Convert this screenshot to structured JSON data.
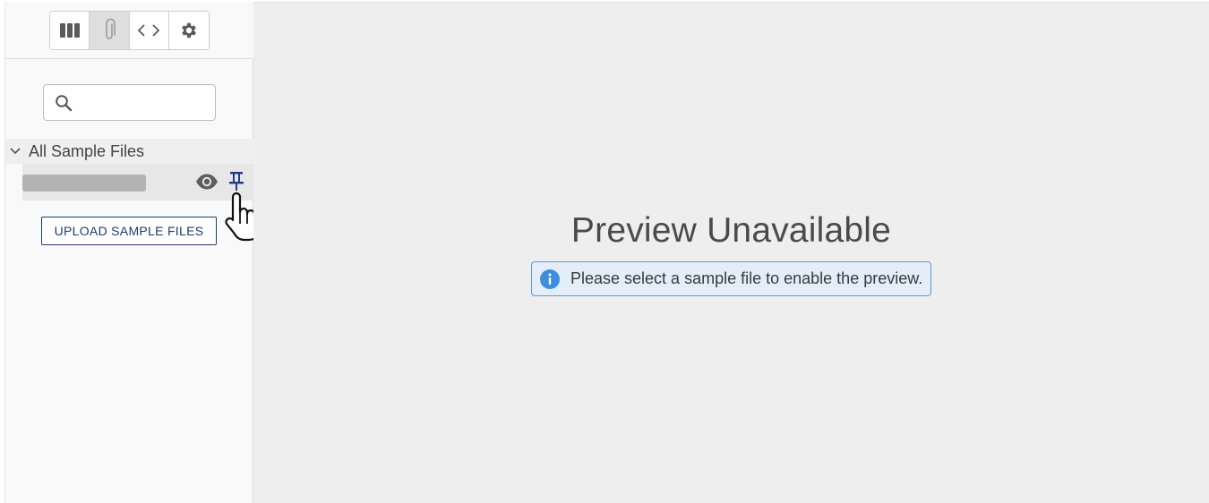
{
  "toolbar": {
    "buttons": [
      {
        "name": "columns-icon",
        "active": false
      },
      {
        "name": "paperclip-icon",
        "active": true
      },
      {
        "name": "code-icon",
        "active": false
      },
      {
        "name": "gear-icon",
        "active": false
      }
    ]
  },
  "search": {
    "placeholder": "",
    "value": ""
  },
  "tree": {
    "root_label": "All Sample Files",
    "expanded": true,
    "items": [
      {
        "name_redacted": true,
        "actions": [
          "eye-icon",
          "pin-icon"
        ]
      }
    ]
  },
  "upload": {
    "label": "UPLOAD SAMPLE FILES"
  },
  "preview": {
    "title": "Preview Unavailable",
    "message": "Please select a sample file to enable the preview."
  },
  "colors": {
    "accent": "#1f3a6b",
    "info_border": "#5b9bd5",
    "info_bg": "#e3eef9",
    "info_icon": "#3d8ee0",
    "pin": "#1f3a8a"
  }
}
